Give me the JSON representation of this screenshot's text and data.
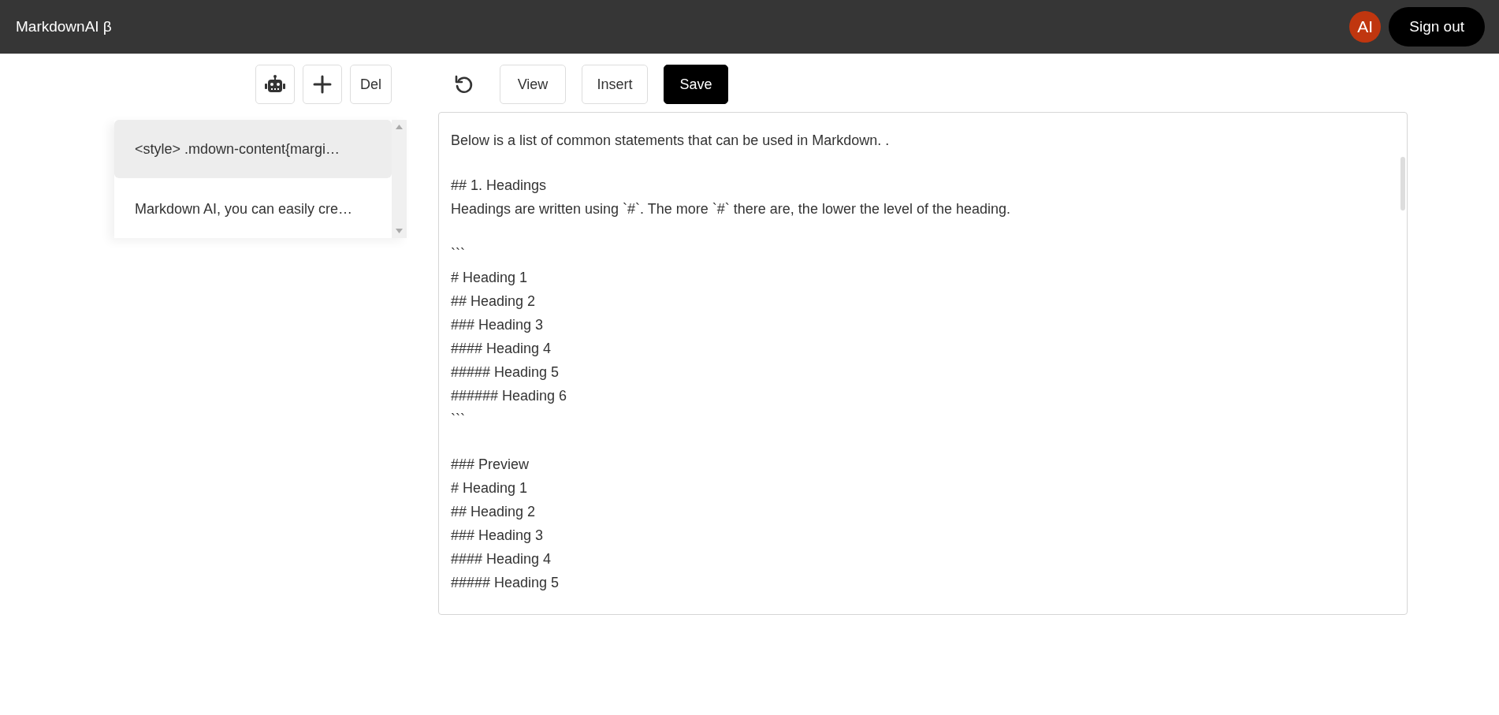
{
  "header": {
    "title": "MarkdownAI β",
    "avatar": "AI",
    "sign_out": "Sign out"
  },
  "sidebar": {
    "buttons": [
      {
        "kind": "robot"
      },
      {
        "kind": "plus"
      },
      {
        "kind": "text",
        "label": "Del"
      }
    ],
    "notes": [
      {
        "text": "<style> .mdown-content{margi…",
        "selected": true
      },
      {
        "text": "Markdown AI, you can easily cre…",
        "selected": false
      }
    ]
  },
  "editor": {
    "toolbar": [
      {
        "kind": "undo"
      },
      {
        "kind": "text",
        "label": "View"
      },
      {
        "kind": "text",
        "label": "Insert"
      },
      {
        "kind": "primary",
        "label": "Save"
      }
    ],
    "blocks": [
      [
        "Below is a list of common statements that can be used in Markdown. ."
      ],
      [
        "## 1. Headings",
        "Headings are written using `#`. The more `#` there are, the lower the level of the heading."
      ],
      [
        "```",
        "# Heading 1",
        "## Heading 2",
        "### Heading 3",
        "#### Heading 4",
        "##### Heading 5",
        "###### Heading 6",
        "```"
      ],
      [
        "### Preview",
        "# Heading 1",
        "## Heading 2",
        "### Heading 3",
        "#### Heading 4",
        "##### Heading 5"
      ]
    ]
  }
}
